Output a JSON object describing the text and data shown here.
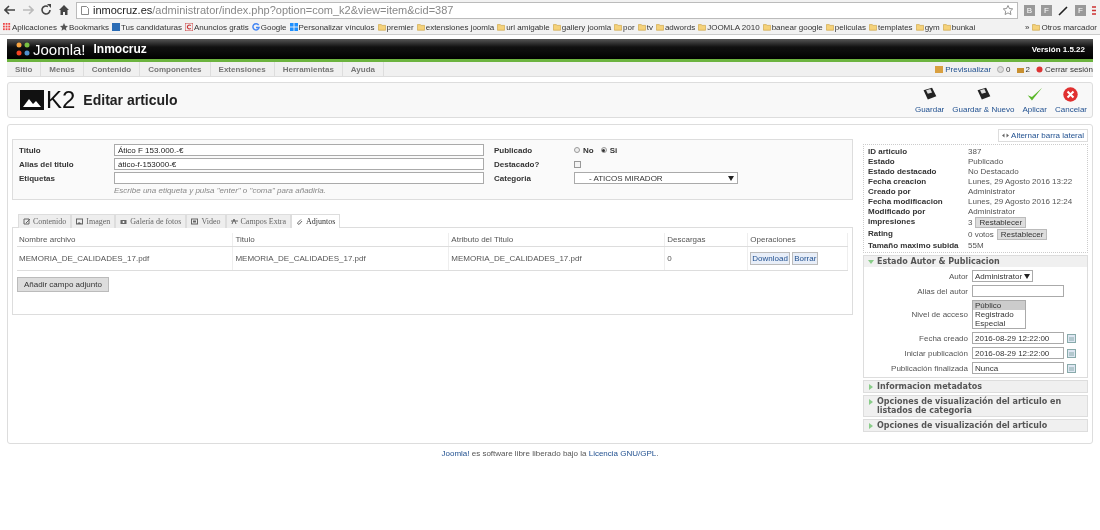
{
  "browser": {
    "url_host": "inmocruz.es",
    "url_path": "/administrator/index.php?option=com_k2&view=item&cid=387",
    "extensions": [
      {
        "kind": "letter",
        "label": "B"
      },
      {
        "kind": "letter",
        "label": "F"
      },
      {
        "kind": "pen"
      },
      {
        "kind": "letter",
        "label": "F"
      }
    ],
    "bookmarks": [
      {
        "kind": "apps",
        "label": "Aplicaciones"
      },
      {
        "kind": "star",
        "label": "Bookmarks"
      },
      {
        "kind": "site",
        "label": "Tus candidaturas"
      },
      {
        "kind": "ad",
        "label": "Anuncios gratis"
      },
      {
        "kind": "google",
        "label": "Google"
      },
      {
        "kind": "windows",
        "label": "Personalizar vínculos"
      },
      {
        "kind": "folder",
        "label": "premier"
      },
      {
        "kind": "folder",
        "label": "extensiones joomla"
      },
      {
        "kind": "folder",
        "label": "url amigable"
      },
      {
        "kind": "folder",
        "label": "gallery joomla"
      },
      {
        "kind": "folder",
        "label": "por"
      },
      {
        "kind": "folder",
        "label": "tv"
      },
      {
        "kind": "folder",
        "label": "adwords"
      },
      {
        "kind": "folder",
        "label": "JOOMLA 2010"
      },
      {
        "kind": "folder",
        "label": "banear google"
      },
      {
        "kind": "folder",
        "label": "peliculas"
      },
      {
        "kind": "folder",
        "label": "templates"
      },
      {
        "kind": "folder",
        "label": "gym"
      },
      {
        "kind": "folder",
        "label": "bunkai"
      }
    ],
    "overflow": "»",
    "other": "Otros marcador"
  },
  "header": {
    "logo": "Joomla!",
    "site": "Inmocruz",
    "version": "Versión 1.5.22"
  },
  "menu": [
    "Sitio",
    "Menús",
    "Contenido",
    "Componentes",
    "Extensiones",
    "Herramientas",
    "Ayuda"
  ],
  "status": {
    "preview": "Previsualizar",
    "messages": "0",
    "users": "2",
    "logout": "Cerrar sesión"
  },
  "toolbar": {
    "logo": "K2",
    "title": "Editar articulo",
    "buttons": [
      {
        "kind": "save",
        "label": "Guardar"
      },
      {
        "kind": "save",
        "label": "Guardar & Nuevo"
      },
      {
        "kind": "apply",
        "label": "Aplicar"
      },
      {
        "kind": "cancel",
        "label": "Cancelar"
      }
    ]
  },
  "form": {
    "title_label": "Titulo",
    "title_value": "Ático F 153.000.-€",
    "alias_label": "Alias del titulo",
    "alias_value": "ático-f-153000-€",
    "tags_label": "Etiquetas",
    "tags_hint": "Escribe una etiqueta y pulsa \"enter\" o \"coma\" para añadirla.",
    "published_label": "Publicado",
    "published_options": [
      {
        "label": "No",
        "selected": false
      },
      {
        "label": "Si",
        "selected": true
      }
    ],
    "featured_label": "Destacado?",
    "featured_checked": false,
    "category_label": "Categoria",
    "category_value": "- ATICOS MIRADOR"
  },
  "tabs": [
    {
      "label": "Contenido",
      "selected": false
    },
    {
      "label": "Imagen",
      "selected": false
    },
    {
      "label": "Galería de fotos",
      "selected": false
    },
    {
      "label": "Video",
      "selected": false
    },
    {
      "label": "Campos Extra",
      "selected": false
    },
    {
      "label": "Adjuntos",
      "selected": true
    }
  ],
  "attachments": {
    "columns": [
      "Nombre archivo",
      "Titulo",
      "Atributo del Titulo",
      "Descargas",
      "Operaciones"
    ],
    "rows": [
      {
        "file": "MEMORIA_DE_CALIDADES_17.pdf",
        "title": "MEMORIA_DE_CALIDADES_17.pdf",
        "attribute": "MEMORIA_DE_CALIDADES_17.pdf",
        "downloads": "0",
        "actions": [
          "Download",
          "Borrar"
        ]
      }
    ],
    "add_button": "Añadir campo adjunto"
  },
  "sidebar": {
    "toggle": "Alternar barra lateral",
    "info": [
      {
        "label": "ID articulo",
        "value": "387"
      },
      {
        "label": "Estado",
        "value": "Publicado"
      },
      {
        "label": "Estado destacado",
        "value": "No Destacado"
      },
      {
        "label": "Fecha creacion",
        "value": "Lunes, 29 Agosto 2016 13:22"
      },
      {
        "label": "Creado por",
        "value": "Administrator"
      },
      {
        "label": "Fecha modificacion",
        "value": "Lunes, 29 Agosto 2016 12:24"
      },
      {
        "label": "Modificado por",
        "value": "Administrator"
      },
      {
        "label": "Impresiones",
        "value": "3",
        "button": "Restablecer"
      },
      {
        "label": "Rating",
        "value": "0 votos",
        "button": "Restablecer"
      },
      {
        "label": "Tamaño maximo subida",
        "value": "55M"
      }
    ],
    "panels": [
      {
        "title": "Estado Autor & Publicacion",
        "expanded": true,
        "fields": [
          {
            "kind": "select",
            "label": "Autor",
            "value": "Administrator"
          },
          {
            "kind": "text",
            "label": "Alias del autor"
          },
          {
            "kind": "list",
            "label": "Nivel de acceso",
            "options": [
              {
                "label": "Público",
                "selected": true
              },
              {
                "label": "Registrado",
                "selected": false
              },
              {
                "label": "Especial",
                "selected": false
              }
            ]
          },
          {
            "kind": "date",
            "label": "Fecha creado",
            "value": "2016-08-29 12:22:00"
          },
          {
            "kind": "date",
            "label": "Iniciar publicación",
            "value": "2016-08-29 12:22:00"
          },
          {
            "kind": "date",
            "label": "Publicación finalizada",
            "value": "Nunca"
          }
        ]
      },
      {
        "title": "Informacion metadatos",
        "expanded": false
      },
      {
        "title": "Opciones de visualización del articulo en listados de categoria",
        "expanded": false
      },
      {
        "title": "Opciones de visualización del articulo",
        "expanded": false
      }
    ]
  },
  "footer": [
    {
      "kind": "link",
      "text": "Joomla!"
    },
    {
      "kind": "text",
      "text": " es software libre liberado bajo la "
    },
    {
      "kind": "link",
      "text": "Licencia GNU/GPL"
    },
    {
      "kind": "text",
      "text": "."
    }
  ]
}
